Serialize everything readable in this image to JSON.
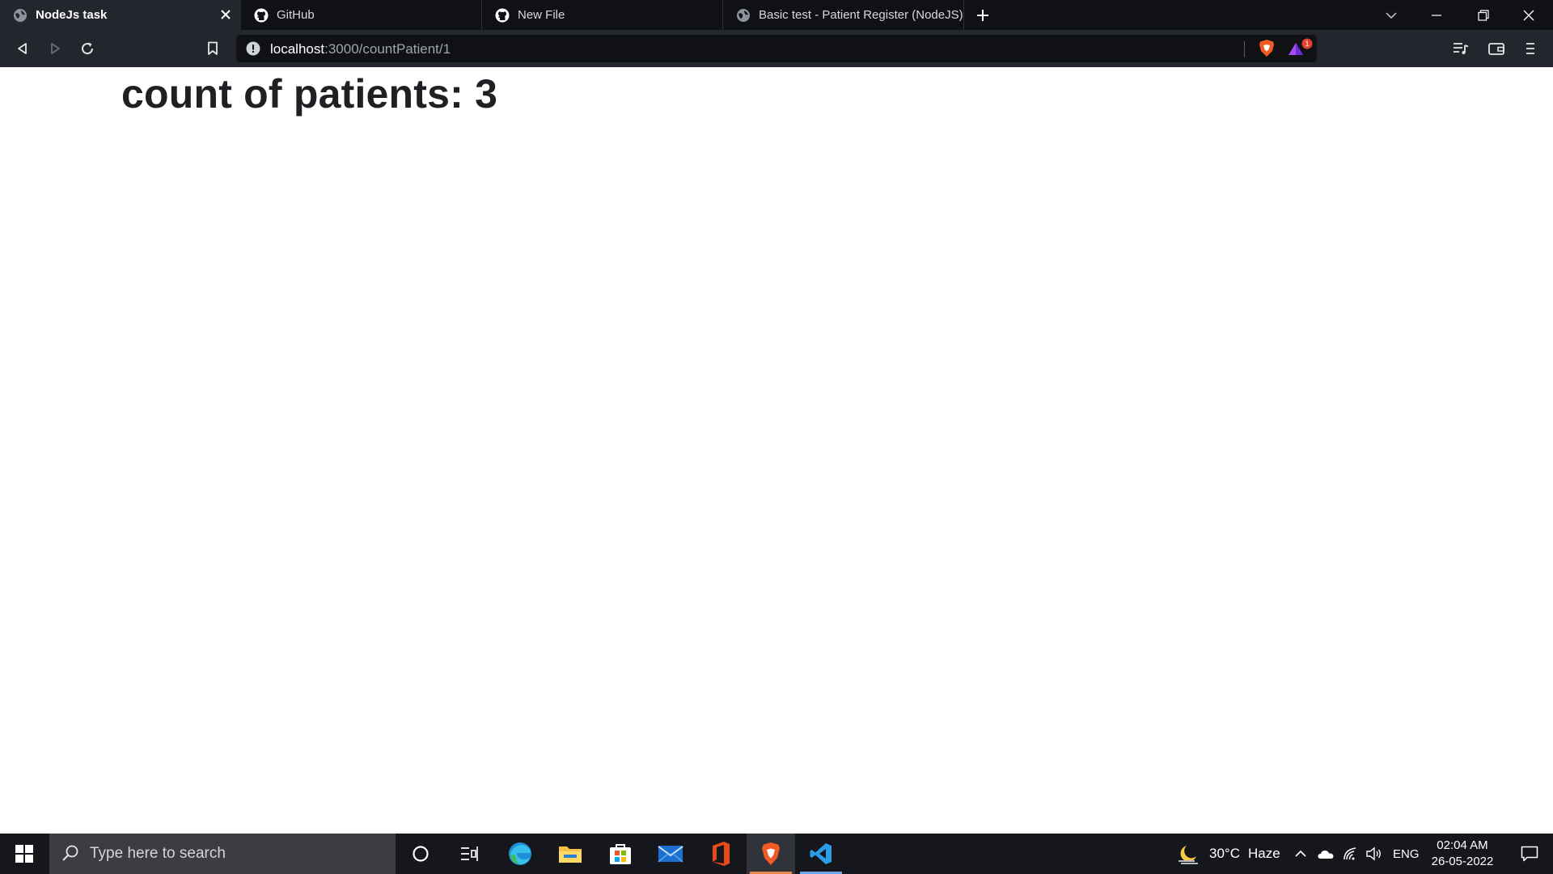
{
  "browser": {
    "tabs": [
      {
        "title": "NodeJs task",
        "icon": "globe-icon",
        "active": true
      },
      {
        "title": "GitHub",
        "icon": "github-icon",
        "active": false
      },
      {
        "title": "New File",
        "icon": "github-icon",
        "active": false
      },
      {
        "title": "Basic test - Patient Register (NodeJS)",
        "icon": "globe-icon",
        "active": false
      }
    ],
    "address": {
      "host": "localhost",
      "path": ":3000/countPatient/1"
    },
    "rewards_badge": "1"
  },
  "page": {
    "heading": "count of patients: 3"
  },
  "taskbar": {
    "search_placeholder": "Type here to search",
    "weather": {
      "temperature": "30°C",
      "condition": "Haze"
    },
    "language": "ENG",
    "time": "02:04 AM",
    "date": "26-05-2022"
  }
}
